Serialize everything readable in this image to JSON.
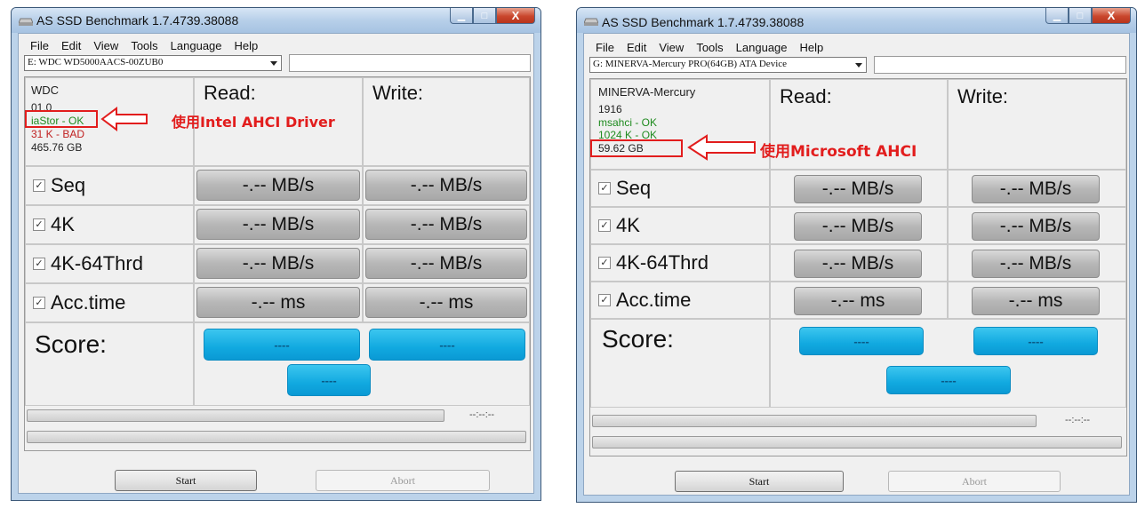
{
  "left": {
    "title": "AS SSD Benchmark 1.7.4739.38088",
    "menu": [
      "File",
      "Edit",
      "View",
      "Tools",
      "Language",
      "Help"
    ],
    "drive": "E: WDC WD5000AACS-00ZUB0",
    "info": {
      "model": "WDC",
      "firmware": "01.0",
      "driver": "iaStor - OK",
      "alignment": "31 K - BAD",
      "size": "465.76 GB"
    },
    "annotation": "使用Intel AHCI Driver",
    "read_header": "Read:",
    "write_header": "Write:",
    "rows": [
      {
        "label": "Seq",
        "read": "-.-- MB/s",
        "write": "-.-- MB/s"
      },
      {
        "label": "4K",
        "read": "-.-- MB/s",
        "write": "-.-- MB/s"
      },
      {
        "label": "4K-64Thrd",
        "read": "-.-- MB/s",
        "write": "-.-- MB/s"
      },
      {
        "label": "Acc.time",
        "read": "-.-- ms",
        "write": "-.-- ms"
      }
    ],
    "score_label": "Score:",
    "score_read": "----",
    "score_write": "----",
    "score_total": "----",
    "time": "--:--:--",
    "start": "Start",
    "abort": "Abort"
  },
  "right": {
    "title": "AS SSD Benchmark 1.7.4739.38088",
    "menu": [
      "File",
      "Edit",
      "View",
      "Tools",
      "Language",
      "Help"
    ],
    "drive": "G: MINERVA-Mercury PRO(64GB) ATA Device",
    "info": {
      "model": "MINERVA-Mercury",
      "firmware": "1916",
      "driver": "msahci - OK",
      "alignment": "1024 K - OK",
      "size": "59.62 GB"
    },
    "annotation": "使用Microsoft AHCI",
    "read_header": "Read:",
    "write_header": "Write:",
    "rows": [
      {
        "label": "Seq",
        "read": "-.-- MB/s",
        "write": "-.-- MB/s"
      },
      {
        "label": "4K",
        "read": "-.-- MB/s",
        "write": "-.-- MB/s"
      },
      {
        "label": "4K-64Thrd",
        "read": "-.-- MB/s",
        "write": "-.-- MB/s"
      },
      {
        "label": "Acc.time",
        "read": "-.-- ms",
        "write": "-.-- ms"
      }
    ],
    "score_label": "Score:",
    "score_read": "----",
    "score_write": "----",
    "score_total": "----",
    "time": "--:--:--",
    "start": "Start",
    "abort": "Abort"
  },
  "colors": {
    "score_blue": "#11a9e0",
    "annotation_red": "#e21d1d",
    "ok_green": "#1f8b1f",
    "bad_red": "#c02020"
  },
  "icons": {
    "app": "hard-drive-icon",
    "minimize": "minimize-icon",
    "maximize": "maximize-icon",
    "close": "close-icon",
    "checkbox": "checkbox-checked-icon",
    "dropdown": "chevron-down-icon",
    "annotation_arrow": "arrow-left-icon"
  }
}
